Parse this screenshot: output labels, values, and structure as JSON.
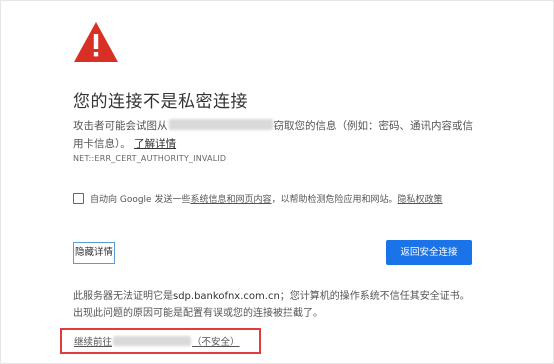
{
  "warning_icon": "warning-triangle-icon",
  "colors": {
    "icon_red": "#d93025",
    "primary_blue": "#1a73e8",
    "highlight_red": "#e03c3c"
  },
  "title": "您的连接不是私密连接",
  "description": {
    "prefix": "攻击者可能会试图从",
    "suffix": "窃取您的信息（例如：密码、通讯内容或信用卡信息）。",
    "learn_more": "了解详情"
  },
  "error_code": "NET::ERR_CERT_AUTHORITY_INVALID",
  "optin": {
    "prefix": "自动向 Google 发送一些",
    "link": "系统信息和网页内容",
    "middle": "，以帮助检测危险应用和网站。",
    "privacy_link": "隐私权政策",
    "checked": false
  },
  "buttons": {
    "details": "隐藏详情",
    "back_to_safety": "返回安全连接"
  },
  "details": {
    "line1_prefix": "此服务器无法证明它是",
    "domain": "sdp.bankofnx.com.cn",
    "line1_suffix": "；您计算机的操作系统不信任其安全证书。",
    "line2": "出现此问题的原因可能是配置有误或您的连接被拦截了。"
  },
  "proceed": {
    "prefix": "继续前往",
    "link": "（不安全）"
  }
}
